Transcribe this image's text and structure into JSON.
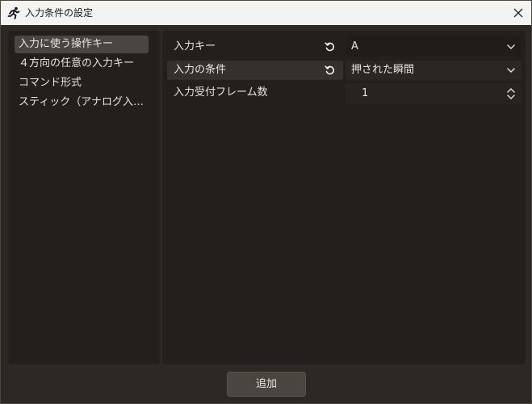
{
  "window": {
    "title": "入力条件の設定"
  },
  "left_list": {
    "items": [
      {
        "label": "入力に使う操作キー",
        "selected": true
      },
      {
        "label": "４方向の任意の入力キー",
        "selected": false
      },
      {
        "label": "コマンド形式",
        "selected": false
      },
      {
        "label": "スティック（アナログ入…",
        "selected": false
      }
    ]
  },
  "settings": {
    "input_key": {
      "label": "入力キー",
      "value": "A"
    },
    "condition": {
      "label": "入力の条件",
      "value": "押された瞬間"
    },
    "frames": {
      "label": "入力受付フレーム数",
      "value": "1"
    }
  },
  "footer": {
    "add_label": "追加"
  },
  "icons": {
    "app": "running-figure-icon",
    "close": "close-icon",
    "reset": "reset-icon",
    "dropdown": "chevron-down-icon",
    "spinner": "spinner-arrows-icon"
  }
}
